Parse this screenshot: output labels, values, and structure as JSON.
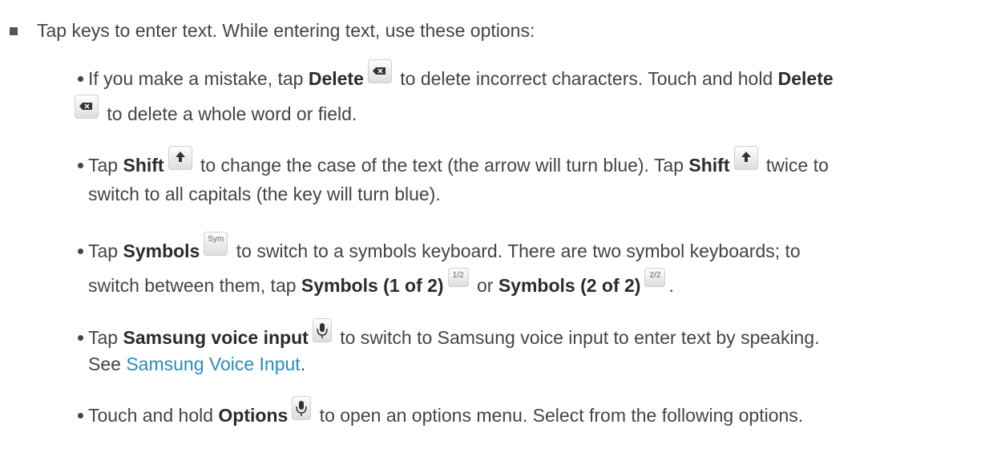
{
  "intro": "Tap keys to enter text. While entering text, use these options:",
  "delete": {
    "t1": "If you make a mistake, tap ",
    "b1": "Delete",
    "t2": " to delete incorrect characters. Touch and hold ",
    "b2": "Delete",
    "t3": " to delete a whole word or field."
  },
  "shift": {
    "t1": "Tap ",
    "b1": "Shift",
    "t2": " to change the case of the text (the arrow will turn blue). Tap ",
    "b2": "Shift",
    "t3": " twice to",
    "t4": "switch to all capitals (the key will turn blue)."
  },
  "symbols": {
    "t1": "Tap ",
    "b1": "Symbols",
    "key_label": "Sym",
    "t2": " to switch to a symbols keyboard. There are two symbol keyboards; to",
    "t3": "switch between them, tap ",
    "b2": "Symbols (1 of 2)",
    "key1_label": "1/2",
    "t4": " or ",
    "b3": "Symbols (2 of 2)",
    "key2_label": "2/2",
    "t5": "."
  },
  "voice": {
    "t1": "Tap ",
    "b1": "Samsung voice input",
    "t2": " to switch to Samsung voice input to enter text by speaking.",
    "t3": "See ",
    "link": "Samsung Voice Input",
    "t4": "."
  },
  "options": {
    "t1": "Touch and hold ",
    "b1": "Options",
    "t2": " to open an options menu. Select from the following options."
  },
  "icons": {
    "delete_key": "backspace-icon",
    "shift_key": "shift-arrow-icon",
    "mic_key": "microphone-icon"
  }
}
